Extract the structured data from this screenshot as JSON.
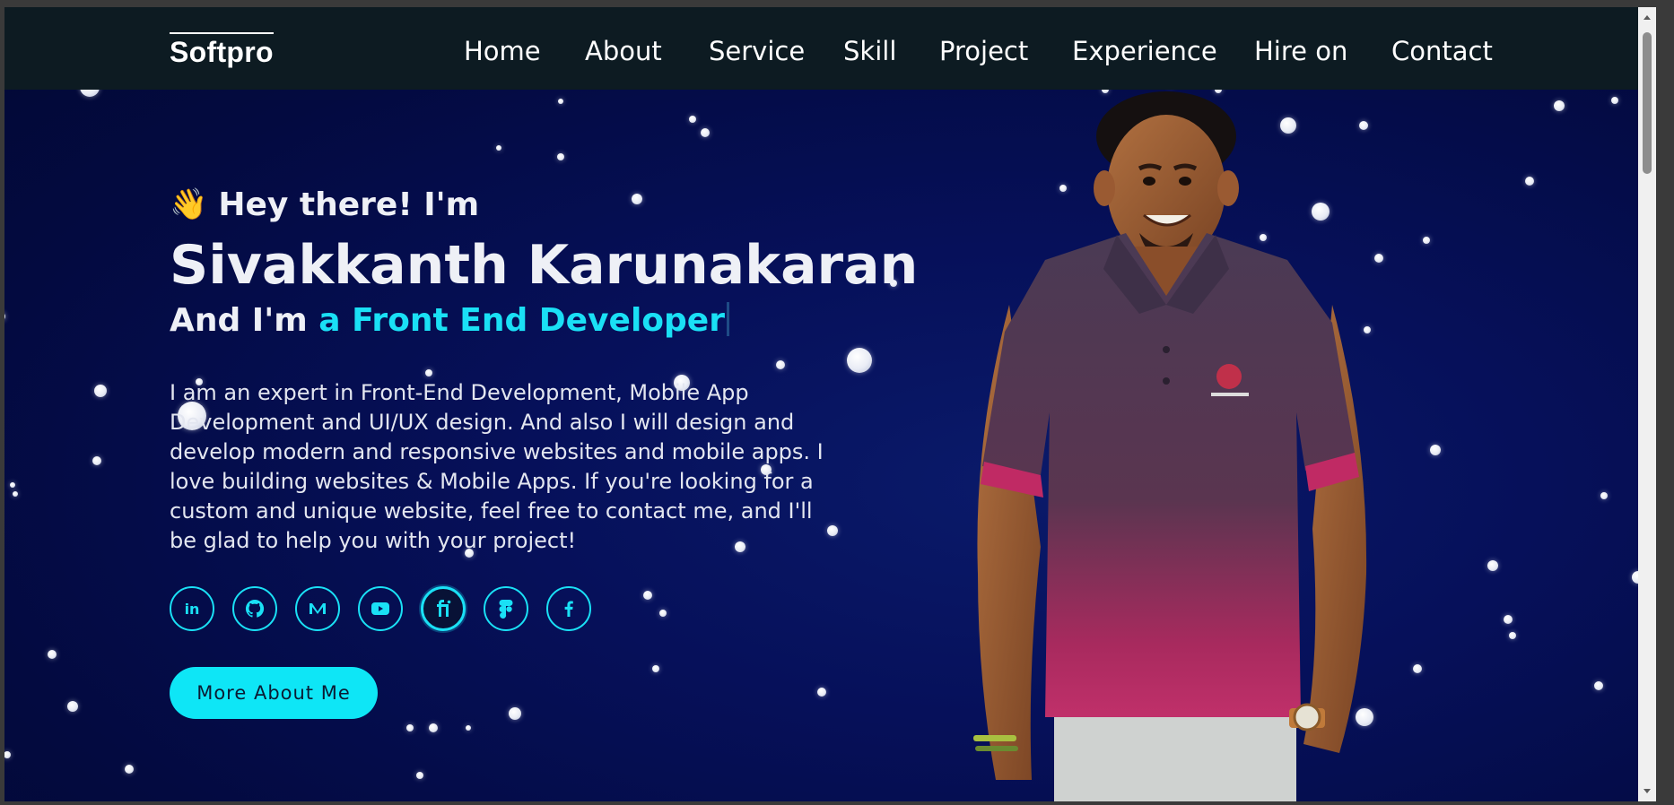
{
  "brand": {
    "logo": "Softpro"
  },
  "nav": {
    "items": [
      "Home",
      "About",
      "Service",
      "Skill",
      "Project",
      "Experience",
      "Hire on",
      "Contact"
    ]
  },
  "hero": {
    "wave_emoji": "👋",
    "greeting": "Hey there! I'm",
    "name": "Sivakkanth Karunakaran",
    "role_prefix": "And I'm ",
    "role_typed": "a Front End Developer",
    "bio": "I am an expert in Front-End Development, Mobile App Development and UI/UX design. And also I will design and develop modern and responsive websites and mobile apps. I love building websites & Mobile Apps. If you're looking for a custom and unique website, feel free to contact me, and I'll be glad to help you with your project!",
    "cta_label": "More About Me"
  },
  "socials": [
    {
      "icon": "linkedin-icon"
    },
    {
      "icon": "github-icon"
    },
    {
      "icon": "medium-icon"
    },
    {
      "icon": "youtube-icon"
    },
    {
      "icon": "fiverr-icon",
      "active": true
    },
    {
      "icon": "figma-icon"
    },
    {
      "icon": "facebook-icon"
    }
  ],
  "colors": {
    "accent": "#1ae0f5",
    "button": "#0ee6f6",
    "navbar": "#0d1b22",
    "background": "#030a40",
    "text": "#eef0f6"
  }
}
